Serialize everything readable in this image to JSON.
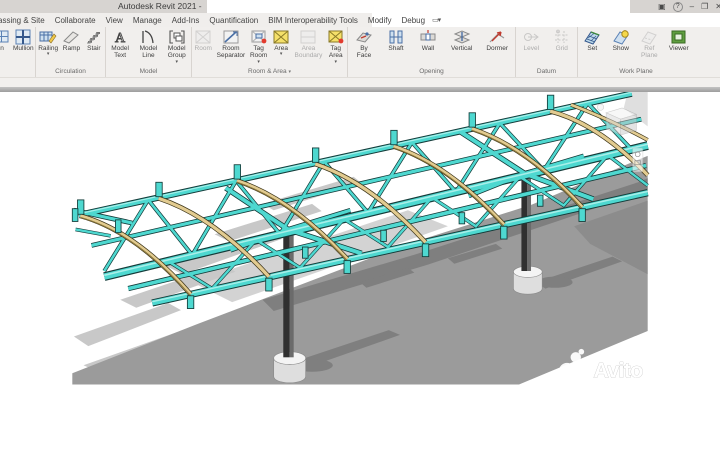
{
  "window": {
    "title": "Autodesk Revit 2021 -",
    "controls": {
      "signin": "▣",
      "help": "?",
      "minimize": "–",
      "restore": "❐",
      "close": "✕"
    }
  },
  "tabs": {
    "items": [
      "assing & Site",
      "Collaborate",
      "View",
      "Manage",
      "Add-Ins",
      "Quantification",
      "BIM Interoperability Tools",
      "Modify",
      "Debug"
    ],
    "overflow": "▭▾"
  },
  "ribbon": {
    "panels": [
      {
        "label": "",
        "buttons": [
          {
            "label": "n"
          },
          {
            "label": "Mullion"
          }
        ]
      },
      {
        "label": "Circulation",
        "buttons": [
          {
            "label": "Railing",
            "dropdown": "▾"
          },
          {
            "label": "Ramp"
          },
          {
            "label": "Stair"
          }
        ]
      },
      {
        "label": "Model",
        "buttons": [
          {
            "label": "Model\nText"
          },
          {
            "label": "Model\nLine"
          },
          {
            "label": "Model\nGroup",
            "dropdown": "▾"
          }
        ]
      },
      {
        "label": "Room & Area",
        "label_dropdown": "▾",
        "buttons": [
          {
            "label": "Room",
            "disabled": true
          },
          {
            "label": "Room\nSeparator"
          },
          {
            "label": "Tag\nRoom",
            "dropdown": "▾"
          },
          {
            "label": "Area",
            "dropdown": "▾"
          },
          {
            "label": "Area\nBoundary",
            "disabled": true
          },
          {
            "label": "Tag\nArea",
            "dropdown": "▾"
          }
        ]
      },
      {
        "label": "Opening",
        "buttons": [
          {
            "label": "By\nFace"
          },
          {
            "label": "Shaft"
          },
          {
            "label": "Wall"
          },
          {
            "label": "Vertical"
          },
          {
            "label": "Dormer"
          }
        ]
      },
      {
        "label": "Datum",
        "buttons": [
          {
            "label": "Level",
            "disabled": true
          },
          {
            "label": "Grid",
            "disabled": true
          }
        ]
      },
      {
        "label": "Work Plane",
        "buttons": [
          {
            "label": "Set"
          },
          {
            "label": "Show"
          },
          {
            "label": "Ref\nPlane",
            "disabled": true
          },
          {
            "label": "Viewer"
          }
        ]
      }
    ]
  },
  "viewport": {
    "watermark": {
      "text": "Avito"
    },
    "colors": {
      "steel": "#4ed8d0",
      "steel_dark": "#143c3a",
      "rafter": "#e2cb90",
      "rafter_dark": "#3c3418",
      "ground": "#9b9b9b",
      "shadow_on_ground": "#7f7f7f",
      "shadow_on_white": "#c8c8c8",
      "column": "#303030",
      "footing": "#e6e6e6"
    }
  }
}
